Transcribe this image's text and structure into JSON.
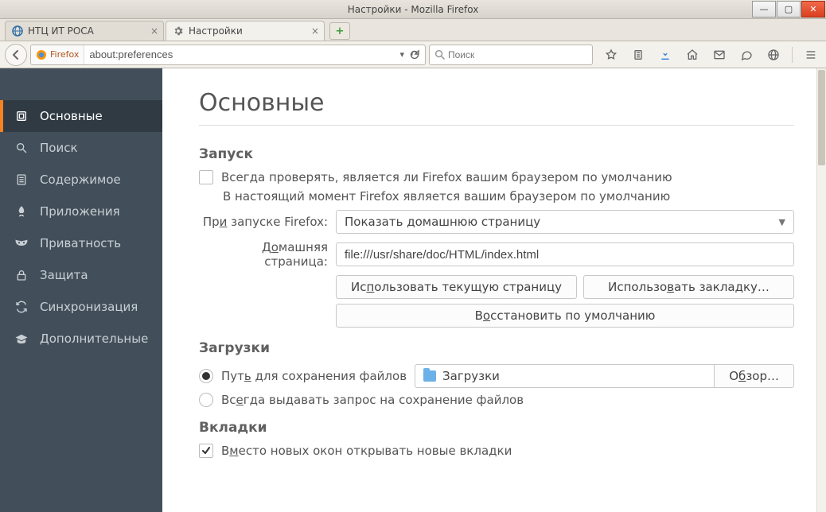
{
  "window": {
    "title": "Настройки - Mozilla Firefox"
  },
  "tabs": [
    {
      "label": "НТЦ ИТ РОСА"
    },
    {
      "label": "Настройки"
    }
  ],
  "addressbar": {
    "chip": "Firefox",
    "url": "about:preferences"
  },
  "search": {
    "placeholder": "Поиск"
  },
  "sidebar": {
    "items": [
      {
        "label": "Основные"
      },
      {
        "label": "Поиск"
      },
      {
        "label": "Содержимое"
      },
      {
        "label": "Приложения"
      },
      {
        "label": "Приватность"
      },
      {
        "label": "Защита"
      },
      {
        "label": "Синхронизация"
      },
      {
        "label": "Дополнительные"
      }
    ]
  },
  "page": {
    "title": "Основные",
    "startup": {
      "heading": "Запуск",
      "default_check_pre": "Всег",
      "default_check_u": "д",
      "default_check_post": "а проверять, является ли Firefox вашим браузером по умолчанию",
      "status": "В настоящий момент Firefox является вашим браузером по умолчанию",
      "on_launch_pre": "Пр",
      "on_launch_u": "и",
      "on_launch_post": " запуске Firefox:",
      "on_launch_value": "Показать домашнюю страницу",
      "homepage_pre": "Д",
      "homepage_u": "о",
      "homepage_post": "машняя страница:",
      "homepage_value": "file:///usr/share/doc/HTML/index.html",
      "btn_current_pre": "Ис",
      "btn_current_u": "п",
      "btn_current_post": "ользовать текущую страницу",
      "btn_bookmark_pre": "Использо",
      "btn_bookmark_u": "в",
      "btn_bookmark_post": "ать закладку…",
      "btn_restore_pre": "В",
      "btn_restore_u": "о",
      "btn_restore_post": "сстановить по умолчанию"
    },
    "downloads": {
      "heading": "Загрузки",
      "save_to_pre": "Пут",
      "save_to_u": "ь",
      "save_to_post": " для сохранения файлов",
      "path_value": "Загрузки",
      "browse_pre": "О",
      "browse_u": "б",
      "browse_post": "зор…",
      "always_ask_pre": "Вс",
      "always_ask_u": "е",
      "always_ask_post": "гда выдавать запрос на сохранение файлов"
    },
    "tabs_section": {
      "heading": "Вкладки",
      "new_windows_pre": "В",
      "new_windows_u": "м",
      "new_windows_post": "есто новых окон открывать новые вкладки"
    }
  }
}
